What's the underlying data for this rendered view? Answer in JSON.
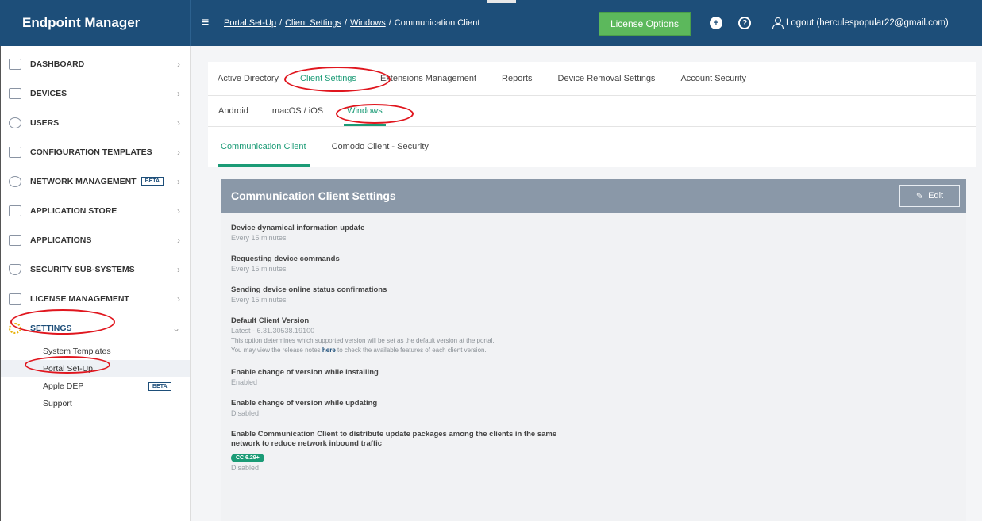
{
  "header": {
    "brand": "Endpoint Manager",
    "breadcrumb": [
      "Portal Set-Up",
      "Client Settings",
      "Windows",
      "Communication Client"
    ],
    "breadcrumb_sep": "/",
    "license_button": "License Options",
    "logout": "Logout (herculespopular22@gmail.com)"
  },
  "sidebar": {
    "items": [
      {
        "label": "DASHBOARD",
        "icon": "dashboard-icon"
      },
      {
        "label": "DEVICES",
        "icon": "devices-icon"
      },
      {
        "label": "USERS",
        "icon": "user-icon"
      },
      {
        "label": "CONFIGURATION TEMPLATES",
        "icon": "templates-icon"
      },
      {
        "label": "NETWORK MANAGEMENT",
        "icon": "network-icon",
        "badge": "BETA"
      },
      {
        "label": "APPLICATION STORE",
        "icon": "store-icon"
      },
      {
        "label": "APPLICATIONS",
        "icon": "applications-icon"
      },
      {
        "label": "SECURITY SUB-SYSTEMS",
        "icon": "shield-icon"
      },
      {
        "label": "LICENSE MANAGEMENT",
        "icon": "license-icon"
      },
      {
        "label": "SETTINGS",
        "icon": "gear-icon"
      }
    ],
    "settings_sub": [
      {
        "label": "System Templates"
      },
      {
        "label": "Portal Set-Up"
      },
      {
        "label": "Apple DEP",
        "badge": "BETA"
      },
      {
        "label": "Support"
      }
    ]
  },
  "tabs": {
    "level1": [
      "Active Directory",
      "Client Settings",
      "Extensions Management",
      "Reports",
      "Device Removal Settings",
      "Account Security"
    ],
    "level2": [
      "Android",
      "macOS / iOS",
      "Windows"
    ],
    "level3": [
      "Communication Client",
      "Comodo Client - Security"
    ]
  },
  "panel": {
    "title": "Communication Client Settings",
    "edit": "Edit",
    "settings": [
      {
        "title": "Device dynamical information update",
        "value": "Every 15 minutes"
      },
      {
        "title": "Requesting device commands",
        "value": "Every 15 minutes"
      },
      {
        "title": "Sending device online status confirmations",
        "value": "Every 15 minutes"
      },
      {
        "title": "Default Client Version",
        "value": "Latest - 6.31.30538.19100"
      },
      {
        "title": "Enable change of version while installing",
        "value": "Enabled"
      },
      {
        "title": "Enable change of version while updating",
        "value": "Disabled"
      },
      {
        "title": "Enable Communication Client to distribute update packages among the clients in the same network to reduce network inbound traffic",
        "value": "Disabled"
      }
    ],
    "note_line1": "This option determines which supported version will be set as the default version at the portal.",
    "note_line2_pre": "You may view the release notes ",
    "note_link": "here",
    "note_line2_post": " to check the available features of each client version.",
    "cc_badge": "CC 6.29+"
  },
  "colors": {
    "topbar": "#1d4e79",
    "accent": "#1b9b76",
    "license_btn": "#5cb85c",
    "highlight_ring": "#e0161e"
  }
}
